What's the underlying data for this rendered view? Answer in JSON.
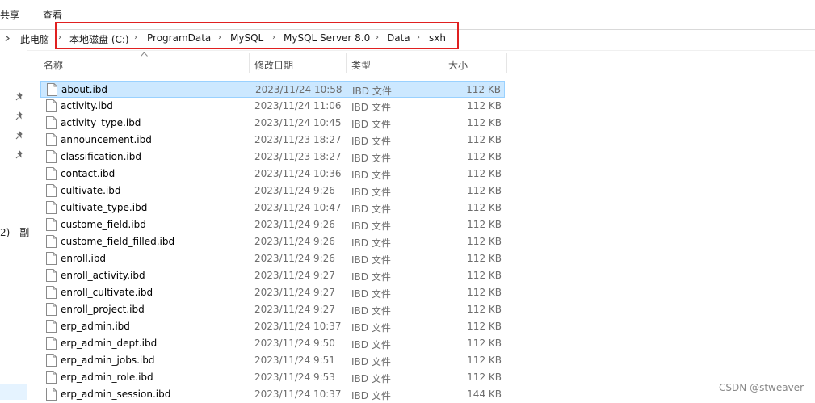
{
  "ribbon": {
    "tab_share": "共享",
    "tab_view": "查看"
  },
  "address_bar": {
    "crumbs": [
      "此电脑",
      "本地磁盘 (C:)",
      "ProgramData",
      "MySQL",
      "MySQL Server 8.0",
      "Data",
      "sxh"
    ]
  },
  "nav_pane": {
    "clipped_label": "2) - 副"
  },
  "columns": {
    "name": "名称",
    "date": "修改日期",
    "type": "类型",
    "size": "大小"
  },
  "files": [
    {
      "name": "about.ibd",
      "date": "2023/11/24 10:58",
      "type": "IBD 文件",
      "size": "112 KB",
      "selected": true
    },
    {
      "name": "activity.ibd",
      "date": "2023/11/24 11:06",
      "type": "IBD 文件",
      "size": "112 KB"
    },
    {
      "name": "activity_type.ibd",
      "date": "2023/11/24 10:45",
      "type": "IBD 文件",
      "size": "112 KB"
    },
    {
      "name": "announcement.ibd",
      "date": "2023/11/23 18:27",
      "type": "IBD 文件",
      "size": "112 KB"
    },
    {
      "name": "classification.ibd",
      "date": "2023/11/23 18:27",
      "type": "IBD 文件",
      "size": "112 KB"
    },
    {
      "name": "contact.ibd",
      "date": "2023/11/24 10:36",
      "type": "IBD 文件",
      "size": "112 KB"
    },
    {
      "name": "cultivate.ibd",
      "date": "2023/11/24 9:26",
      "type": "IBD 文件",
      "size": "112 KB"
    },
    {
      "name": "cultivate_type.ibd",
      "date": "2023/11/24 10:47",
      "type": "IBD 文件",
      "size": "112 KB"
    },
    {
      "name": "custome_field.ibd",
      "date": "2023/11/24 9:26",
      "type": "IBD 文件",
      "size": "112 KB"
    },
    {
      "name": "custome_field_filled.ibd",
      "date": "2023/11/24 9:26",
      "type": "IBD 文件",
      "size": "112 KB"
    },
    {
      "name": "enroll.ibd",
      "date": "2023/11/24 9:26",
      "type": "IBD 文件",
      "size": "112 KB"
    },
    {
      "name": "enroll_activity.ibd",
      "date": "2023/11/24 9:27",
      "type": "IBD 文件",
      "size": "112 KB"
    },
    {
      "name": "enroll_cultivate.ibd",
      "date": "2023/11/24 9:27",
      "type": "IBD 文件",
      "size": "112 KB"
    },
    {
      "name": "enroll_project.ibd",
      "date": "2023/11/24 9:27",
      "type": "IBD 文件",
      "size": "112 KB"
    },
    {
      "name": "erp_admin.ibd",
      "date": "2023/11/24 10:37",
      "type": "IBD 文件",
      "size": "112 KB"
    },
    {
      "name": "erp_admin_dept.ibd",
      "date": "2023/11/24 9:50",
      "type": "IBD 文件",
      "size": "112 KB"
    },
    {
      "name": "erp_admin_jobs.ibd",
      "date": "2023/11/24 9:51",
      "type": "IBD 文件",
      "size": "112 KB"
    },
    {
      "name": "erp_admin_role.ibd",
      "date": "2023/11/24 9:53",
      "type": "IBD 文件",
      "size": "112 KB"
    },
    {
      "name": "erp_admin_session.ibd",
      "date": "2023/11/24 10:37",
      "type": "IBD 文件",
      "size": "144 KB"
    }
  ],
  "watermark": "CSDN @stweaver",
  "colors": {
    "selection_bg": "#cce8ff",
    "selection_border": "#99d1ff",
    "highlight_box": "#e02020"
  }
}
